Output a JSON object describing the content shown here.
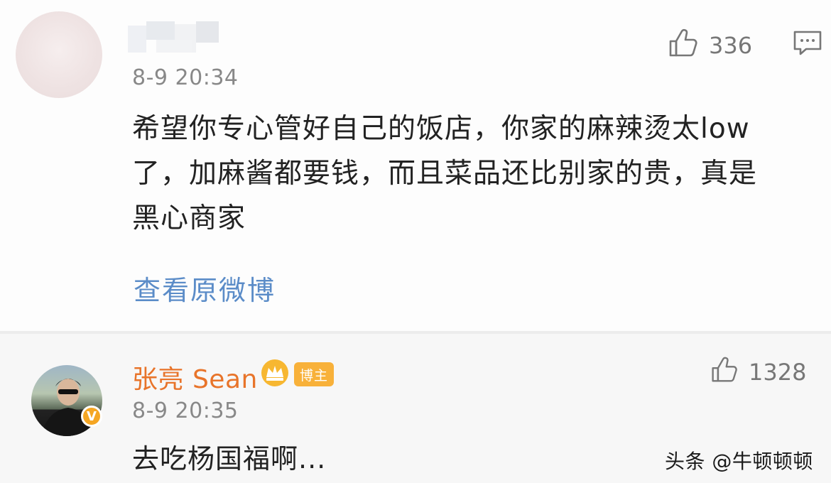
{
  "comment": {
    "timestamp": "8-9 20:34",
    "like_count": "336",
    "text": "希望你专心管好自己的饭店，你家的麻辣烫太low了，加麻酱都要钱，而且菜品还比别家的贵，真是黑心商家",
    "view_original_label": "查看原微博"
  },
  "reply": {
    "username": "张亮 Sean",
    "author_badge": "博主",
    "verified_mark": "V",
    "timestamp": "8-9 20:35",
    "like_count": "1328",
    "text": "去吃杨国福啊..."
  },
  "watermark": "头条 @牛顿顿顿",
  "colors": {
    "username": "#e8742a",
    "link": "#5b8cc8",
    "badge": "#f8b13a",
    "meta": "#888888"
  },
  "icons": [
    "thumbs-up-icon",
    "comment-bubble-icon",
    "crown-icon",
    "verified-icon"
  ]
}
